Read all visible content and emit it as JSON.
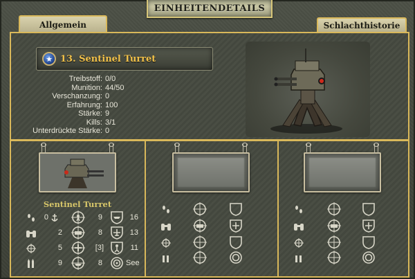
{
  "window": {
    "title": "EINHEITENDETAILS"
  },
  "tabs": {
    "general": "Allgemein",
    "history": "Schlachthistorie"
  },
  "unit": {
    "name": "13. Sentinel Turret",
    "stats": [
      {
        "label": "Treibstoff:",
        "value": "0/0"
      },
      {
        "label": "Munition:",
        "value": "44/50"
      },
      {
        "label": "Verschanzung:",
        "value": "0"
      },
      {
        "label": "Erfahrung:",
        "value": "100"
      },
      {
        "label": "Stärke:",
        "value": "9"
      },
      {
        "label": "Kills:",
        "value": "3/1"
      },
      {
        "label": "Unterdrückte Stärke:",
        "value": "0"
      }
    ]
  },
  "slots": [
    {
      "name": "Sentinel Turret",
      "values": {
        "movement": "0",
        "infantry_attack": "2",
        "vision": "2",
        "soft_attack": "9",
        "range": "5",
        "hard_attack": "[3]",
        "ammo": "9",
        "air_attack": "8",
        "naval_attack": "16",
        "defense": "8",
        "close_defense": "13",
        "ground_defense": "11",
        "initiative": "See"
      }
    },
    {
      "name": "",
      "values": {}
    },
    {
      "name": "",
      "values": {}
    }
  ],
  "icons": {
    "col_a": [
      "footprints-icon",
      "binoculars-icon",
      "range-icon",
      "ammo-icon"
    ],
    "col_b": [
      "crosshair-soldier-icon",
      "crosshair-tank-icon",
      "crosshair-plane-icon",
      "crosshair-ship-icon"
    ],
    "col_c": [
      "shield-tank-icon",
      "shield-plane-icon",
      "shield-soldier-icon",
      "target-icon"
    ],
    "extra": "anchor-icon"
  },
  "colors": {
    "gold": "#d9b85a",
    "unit_name": "#f1c14a",
    "sub_name": "#d8c76a"
  }
}
